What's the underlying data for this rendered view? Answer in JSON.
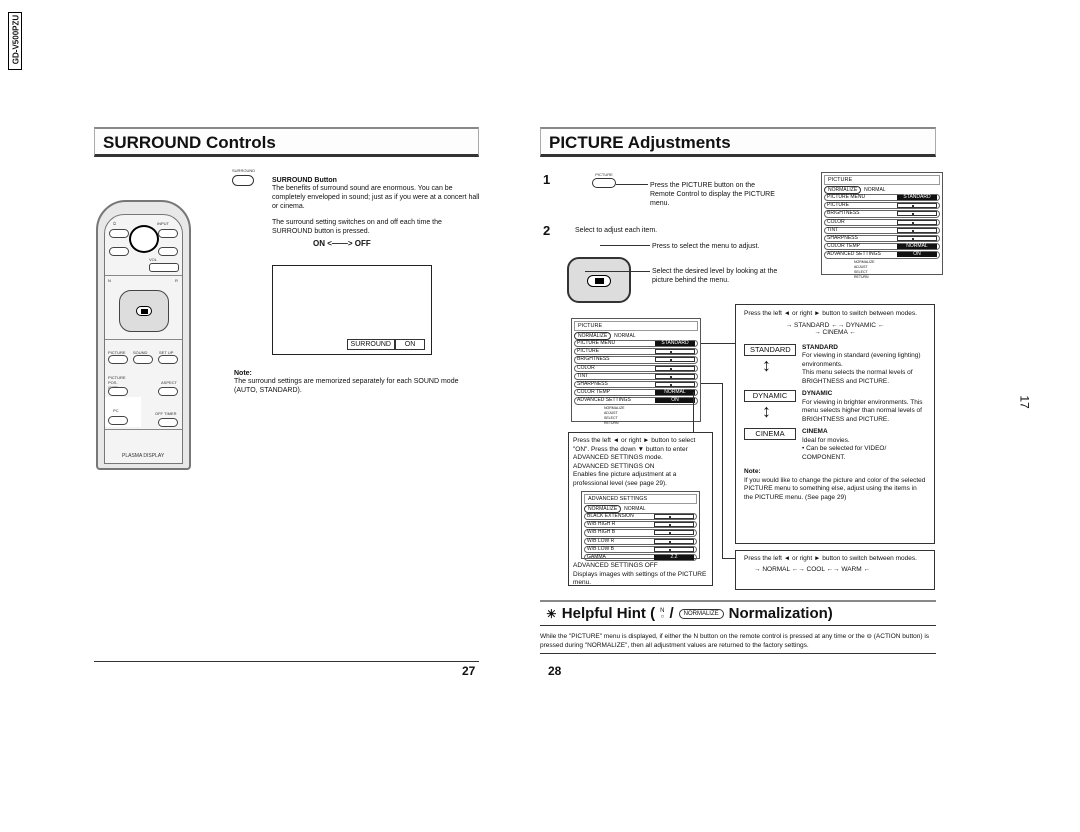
{
  "side_label": "GD-V500PZU",
  "left": {
    "title": "SURROUND Controls",
    "remote": {
      "surround": "SURROUND",
      "input": "INPUT",
      "vol": "VOL",
      "minus": "−",
      "plus": "+",
      "n": "N",
      "r": "R",
      "picture": "PICTURE",
      "sound": "SOUND",
      "setup": "SET UP",
      "picture_pos": "PICTURE POS. /SIZE",
      "aspect": "ASPECT",
      "pc": "PC",
      "off_timer": "OFF TIMER",
      "brand": "PLASMA DISPLAY"
    },
    "button_label": "SURROUND",
    "heading": "SURROUND Button",
    "para1": "The benefits of surround sound are enormous. You can be completely enveloped in sound; just as if you were at a concert hall or cinema.",
    "para2": "The surround setting switches on and off each time the SURROUND button is pressed.",
    "on": "ON",
    "off": "OFF",
    "osd_label": "SURROUND",
    "osd_value": "ON",
    "note_title": "Note:",
    "note": "The surround settings are memorized separately for each SOUND mode (AUTO, STANDARD).",
    "page": "27"
  },
  "right": {
    "title": "PICTURE Adjustments",
    "step1": "1",
    "step1_button": "PICTURE",
    "step1_text": "Press the PICTURE button on the Remote Control to display the PICTURE menu.",
    "step2": "2",
    "step2_text": "Select to adjust each item.",
    "select_menu": "Press to select the menu to adjust.",
    "select_level": "Select the desired level by looking at the picture behind the menu.",
    "menu": {
      "title": "PICTURE",
      "normalize": "NORMALIZE",
      "normal": "NORMAL",
      "rows": [
        {
          "label": "PICTURE MENU",
          "value": "STANDARD"
        },
        {
          "label": "PICTURE",
          "value": ""
        },
        {
          "label": "BRIGHTNESS",
          "value": ""
        },
        {
          "label": "COLOR",
          "value": ""
        },
        {
          "label": "TINT",
          "value": ""
        },
        {
          "label": "SHARPNESS",
          "value": ""
        },
        {
          "label": "COLOR TEMP",
          "value": "NORMAL"
        },
        {
          "label": "ADVANCED SETTINGS",
          "value": "ON"
        }
      ],
      "help": [
        "NORMALIZE",
        "ADJUST",
        "SELECT",
        "RETURN"
      ]
    },
    "adv_box": {
      "text": "Press the left ◄ or right ► button to select \"ON\". Press the down ▼ button to enter ADVANCED SETTINGS mode.",
      "on_title": "ADVANCED SETTINGS ON",
      "on_text": "Enables fine picture adjustment at a professional level (see page 29).",
      "menu_title": "ADVANCED SETTINGS",
      "normalize": "NORMALIZE",
      "normal": "NORMAL",
      "rows": [
        {
          "label": "BLACK EXTENSION",
          "value": ""
        },
        {
          "label": "W/B HIGH R",
          "value": ""
        },
        {
          "label": "W/B HIGH B",
          "value": ""
        },
        {
          "label": "W/B LOW R",
          "value": ""
        },
        {
          "label": "W/B LOW B",
          "value": ""
        },
        {
          "label": "GAMMA",
          "value": "2.2"
        }
      ],
      "off_title": "ADVANCED SETTINGS OFF",
      "off_text": "Displays images with settings of the PICTURE menu."
    },
    "mode_box": {
      "intro": "Press the left ◄ or right ► button to switch between modes.",
      "flow": [
        "STANDARD",
        "DYNAMIC",
        "CINEMA"
      ],
      "modes": [
        {
          "tag": "STANDARD",
          "title": "STANDARD",
          "text": "For viewing in standard (evening lighting) environments.\nThis menu selects the normal levels of BRIGHTNESS and PICTURE."
        },
        {
          "tag": "DYNAMIC",
          "title": "DYNAMIC",
          "text": "For viewing in brighter environments. This menu selects higher than normal levels of BRIGHTNESS and PICTURE."
        },
        {
          "tag": "CINEMA",
          "title": "CINEMA",
          "text": "Ideal for movies.\n• Can be selected for VIDEO/ COMPONENT."
        }
      ],
      "note_title": "Note:",
      "note": "If you would like to change the picture and color of the selected PICTURE menu to something else, adjust using the items in the PICTURE menu. (See page 29)"
    },
    "temp_box": {
      "intro": "Press the left ◄ or right ► button to switch between modes.",
      "flow": [
        "NORMAL",
        "COOL",
        "WARM"
      ]
    },
    "hint": {
      "prefix": "Helpful Hint (",
      "n": "N",
      "slash": "/",
      "normalize": "NORMALIZE",
      "suffix": "Normalization)",
      "text": "While the \"PICTURE\" menu is displayed, if either the N button on the remote control is pressed at any time or the ⊖ (ACTION button) is pressed during \"NORMALIZE\", then all adjustment values are returned to the factory settings."
    },
    "page": "28"
  },
  "margin_page": "17"
}
